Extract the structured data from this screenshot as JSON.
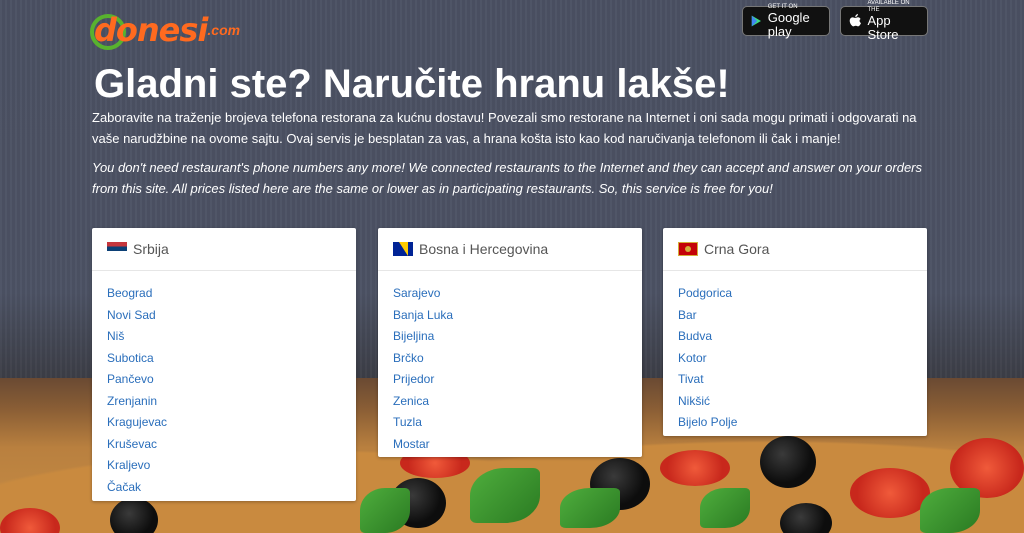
{
  "header": {
    "logo_text": "donesi",
    "logo_suffix": ".com",
    "google_play": {
      "small": "GET IT ON",
      "big": "Google play"
    },
    "app_store": {
      "small": "Available on the",
      "big": "App Store"
    }
  },
  "hero": {
    "headline": "Gladni ste? Naručite hranu lakše!",
    "intro_sr": "Zaboravite na traženje brojeva telefona restorana za kućnu dostavu! Povezali smo restorane na Internet i oni sada mogu primati i odgovarati na vaše narudžbine na ovome sajtu. Ovaj servis je besplatan za vas, a hrana košta isto kao kod naručivanja telefonom ili čak i manje!",
    "intro_en": "You don't need restaurant's phone numbers any more! We connected restaurants to the Internet and they can accept and answer on your orders from this site. All prices listed here are the same or lower as in participating restaurants. So, this service is free for you!"
  },
  "countries": [
    {
      "name": "Srbija",
      "flag": "serbia-flag-icon",
      "cities": [
        "Beograd",
        "Novi Sad",
        "Niš",
        "Subotica",
        "Pančevo",
        "Zrenjanin",
        "Kragujevac",
        "Kruševac",
        "Kraljevo",
        "Čačak"
      ]
    },
    {
      "name": "Bosna i Hercegovina",
      "flag": "bosnia-flag-icon",
      "cities": [
        "Sarajevo",
        "Banja Luka",
        "Bijeljina",
        "Brčko",
        "Prijedor",
        "Zenica",
        "Tuzla",
        "Mostar"
      ]
    },
    {
      "name": "Crna Gora",
      "flag": "montenegro-flag-icon",
      "cities": [
        "Podgorica",
        "Bar",
        "Budva",
        "Kotor",
        "Tivat",
        "Nikšić",
        "Bijelo Polje"
      ]
    }
  ],
  "colors": {
    "brand_orange": "#ff6a1f",
    "brand_green": "#58b22e",
    "link_blue": "#2a6ebb"
  }
}
